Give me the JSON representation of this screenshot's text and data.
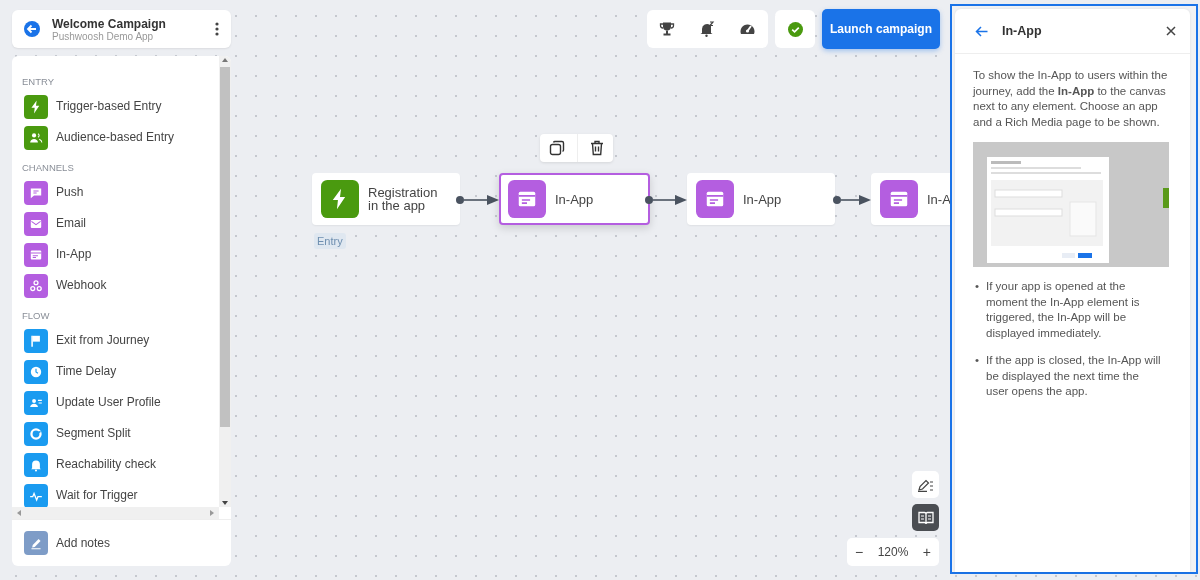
{
  "header": {
    "title": "Welcome Campaign",
    "subtitle": "Pushwoosh Demo App"
  },
  "palette": {
    "sections": [
      {
        "title": "ENTRY",
        "color": "#4a9a0f",
        "items": [
          {
            "label": "Trigger-based Entry",
            "kind": "bolt"
          },
          {
            "label": "Audience-based Entry",
            "kind": "people"
          }
        ]
      },
      {
        "title": "CHANNELS",
        "color": "#b45ee0",
        "items": [
          {
            "label": "Push",
            "kind": "message"
          },
          {
            "label": "Email",
            "kind": "envelope"
          },
          {
            "label": "In-App",
            "kind": "window"
          },
          {
            "label": "Webhook",
            "kind": "webhook"
          }
        ]
      },
      {
        "title": "FLOW",
        "color": "#1a9bf0",
        "items": [
          {
            "label": "Exit from Journey",
            "kind": "flag"
          },
          {
            "label": "Time Delay",
            "kind": "clock"
          },
          {
            "label": "Update User Profile",
            "kind": "profile"
          },
          {
            "label": "Segment Split",
            "kind": "split"
          },
          {
            "label": "Reachability check",
            "kind": "bell"
          },
          {
            "label": "Wait for Trigger",
            "kind": "pulse"
          }
        ]
      }
    ],
    "footer": {
      "label": "Add notes",
      "kind": "pencil",
      "color": "#7e9cc7"
    }
  },
  "toolbar": {
    "launch_button": "Launch campaign"
  },
  "nodes": [
    {
      "label": "Registration in the app",
      "kind": "bolt",
      "color": "#4a9a0f",
      "selected": false,
      "tag": "Entry"
    },
    {
      "label": "In-App",
      "kind": "window",
      "color": "#b45ee0",
      "selected": true
    },
    {
      "label": "In-App",
      "kind": "window",
      "color": "#b45ee0",
      "selected": false
    },
    {
      "label": "In-A",
      "kind": "window",
      "color": "#b45ee0",
      "selected": false
    }
  ],
  "zoom": {
    "minus": "−",
    "value": "120%",
    "plus": "+"
  },
  "help_panel": {
    "title": "In-App",
    "marker": "•",
    "intro": "To show the In-App to users within the journey, add the **In-App** to the canvas next to any element. Choose an app and a Rich Media page to be shown.",
    "bullets": [
      "If your app is opened at the moment the In-App element is triggered, the In-App will be displayed immediately.",
      "If the app is closed, the In-App will be displayed the next time the user opens the app."
    ]
  }
}
